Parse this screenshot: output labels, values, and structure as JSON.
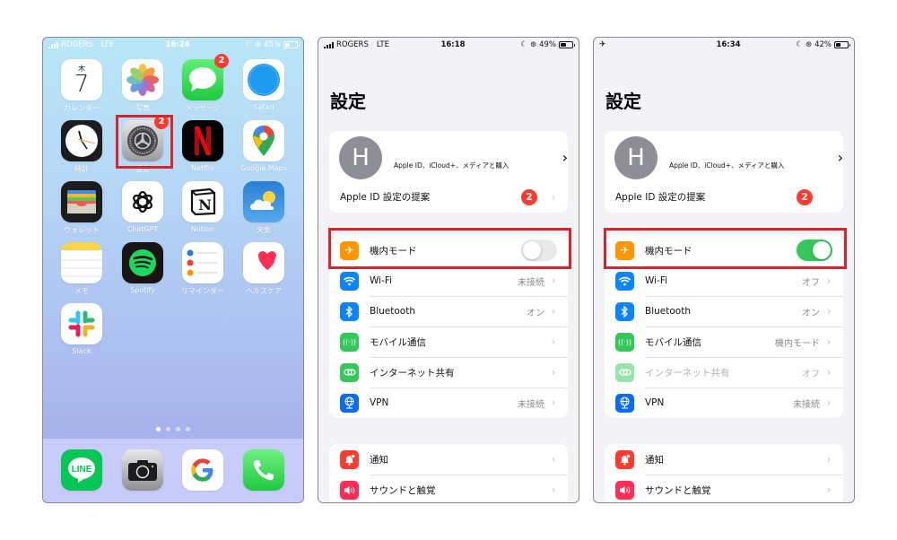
{
  "colors": {
    "highlight": "#d7262b",
    "badge": "#ff3b30",
    "toggle_on": "#34c759",
    "toggle_off": "#e9e9eb",
    "settings_bg": "#f2f2f7"
  },
  "home": {
    "status": {
      "carrier": "ROGERS",
      "network": "LTE",
      "time": "16:24",
      "battery": "45%",
      "battery_level": 0.45
    },
    "apps": [
      {
        "name": "calendar",
        "label": "カレンダー",
        "weekday": "木",
        "day": "7"
      },
      {
        "name": "photos",
        "label": "写真"
      },
      {
        "name": "messages",
        "label": "メッセージ",
        "badge": "2"
      },
      {
        "name": "safari",
        "label": "Safari"
      },
      {
        "name": "clock",
        "label": "時計"
      },
      {
        "name": "settings",
        "label": "設定",
        "badge": "2",
        "highlighted": true
      },
      {
        "name": "netflix",
        "label": "Netflix"
      },
      {
        "name": "google-maps",
        "label": "Google Maps"
      },
      {
        "name": "wallet",
        "label": "ウォレット"
      },
      {
        "name": "chatgpt",
        "label": "ChatGPT"
      },
      {
        "name": "notion",
        "label": "Notion"
      },
      {
        "name": "weather",
        "label": "天気"
      },
      {
        "name": "notes",
        "label": "メモ"
      },
      {
        "name": "spotify",
        "label": "Spotify"
      },
      {
        "name": "reminders",
        "label": "リマインダー"
      },
      {
        "name": "health",
        "label": "ヘルスケア"
      },
      {
        "name": "slack",
        "label": "Slack"
      }
    ],
    "page_dots": {
      "count": 4,
      "active": 1
    },
    "dock": [
      {
        "name": "line",
        "text": "LINE"
      },
      {
        "name": "camera"
      },
      {
        "name": "google",
        "text": "G"
      },
      {
        "name": "phone"
      }
    ]
  },
  "settings_off": {
    "status": {
      "carrier": "ROGERS",
      "network": "LTE",
      "time": "16:18",
      "battery": "49%",
      "battery_level": 0.49
    },
    "title": "設定",
    "profile": {
      "initial": "H",
      "subtitle": "Apple ID、iCloud+、メディアと購入"
    },
    "apple_suggest": {
      "label": "Apple ID 設定の提案",
      "badge": "2"
    },
    "airplane": {
      "label": "機内モード",
      "on": false
    },
    "rows": [
      {
        "label": "Wi-Fi",
        "value": "未接続"
      },
      {
        "label": "Bluetooth",
        "value": "オン"
      },
      {
        "label": "モバイル通信",
        "value": ""
      },
      {
        "label": "インターネット共有",
        "value": ""
      },
      {
        "label": "VPN",
        "value": "未接続"
      }
    ],
    "rows2": [
      {
        "label": "通知"
      },
      {
        "label": "サウンドと触覚"
      }
    ]
  },
  "settings_on": {
    "status": {
      "airplane_icon": "✈",
      "time": "16:34",
      "battery": "42%",
      "battery_level": 0.42
    },
    "title": "設定",
    "profile": {
      "initial": "H",
      "subtitle": "Apple ID、iCloud+、メディアと購入"
    },
    "apple_suggest": {
      "label": "Apple ID 設定の提案",
      "badge": "2"
    },
    "airplane": {
      "label": "機内モード",
      "on": true
    },
    "rows": [
      {
        "label": "Wi-Fi",
        "value": "オフ"
      },
      {
        "label": "Bluetooth",
        "value": "オン"
      },
      {
        "label": "モバイル通信",
        "value": "機内モード"
      },
      {
        "label": "インターネット共有",
        "value": "オフ",
        "disabled": true
      },
      {
        "label": "VPN",
        "value": "未接続"
      }
    ],
    "rows2": [
      {
        "label": "通知"
      },
      {
        "label": "サウンドと触覚"
      }
    ]
  }
}
